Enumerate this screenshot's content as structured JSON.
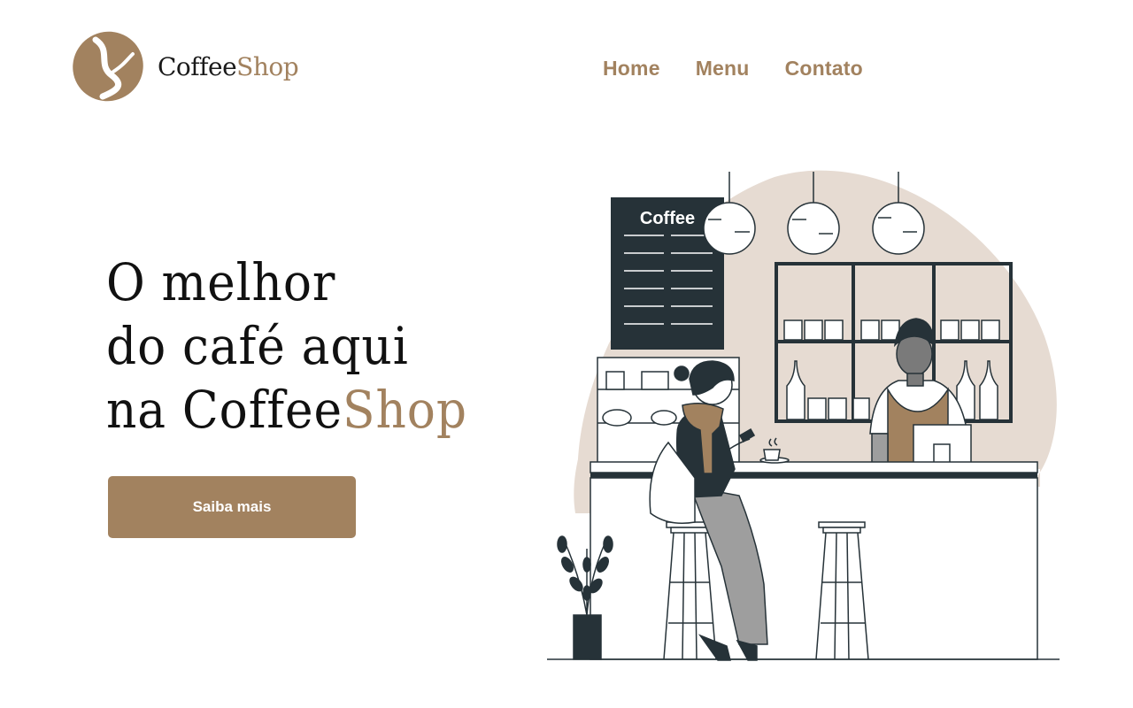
{
  "brand": {
    "name_part1": "Coffee",
    "name_part2": "Shop",
    "accent_color": "#a2825f",
    "logo_icon": "coffee-bean-icon"
  },
  "nav": {
    "items": [
      "Home",
      "Menu",
      "Contato"
    ]
  },
  "hero": {
    "line1": "O melhor",
    "line2": "do café aqui",
    "line3_prefix": "na Coffee",
    "line3_accent": "Shop",
    "cta_label": "Saiba mais"
  },
  "illustration": {
    "menu_board_title": "Coffee"
  }
}
